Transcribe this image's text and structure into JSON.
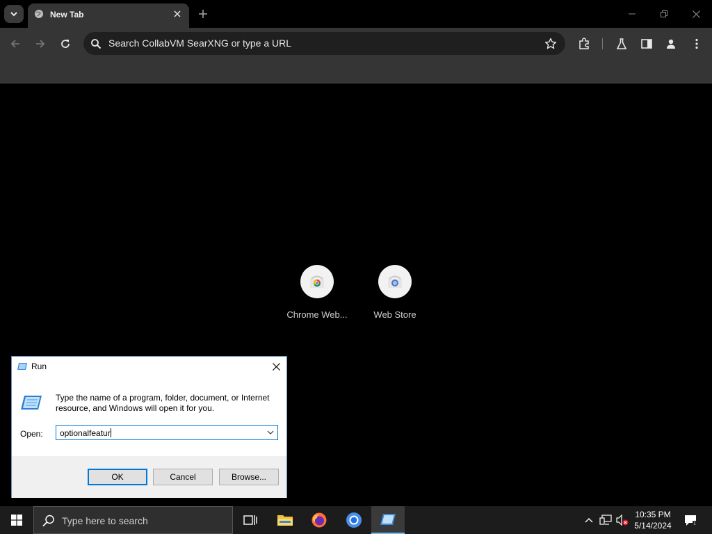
{
  "browser": {
    "tab": {
      "title": "New Tab"
    },
    "omnibox": {
      "placeholder": "Search CollabVM SearXNG or type a URL"
    },
    "shortcuts": [
      {
        "label": "Chrome Web..."
      },
      {
        "label": "Web Store"
      }
    ]
  },
  "run_dialog": {
    "title": "Run",
    "description": "Type the name of a program, folder, document, or Internet resource, and Windows will open it for you.",
    "open_label": "Open:",
    "open_value": "optionalfeatur",
    "ok_label": "OK",
    "cancel_label": "Cancel",
    "browse_label": "Browse..."
  },
  "taskbar": {
    "search_placeholder": "Type here to search",
    "apps": [
      "task-view-icon",
      "file-explorer-icon",
      "firefox-icon",
      "chrome-icon",
      "run-icon"
    ],
    "clock_time": "10:35 PM",
    "clock_date": "5/14/2024"
  },
  "colors": {
    "accent": "#0078d7",
    "toolbar": "#353535",
    "taskbar": "#1c1c1c"
  }
}
